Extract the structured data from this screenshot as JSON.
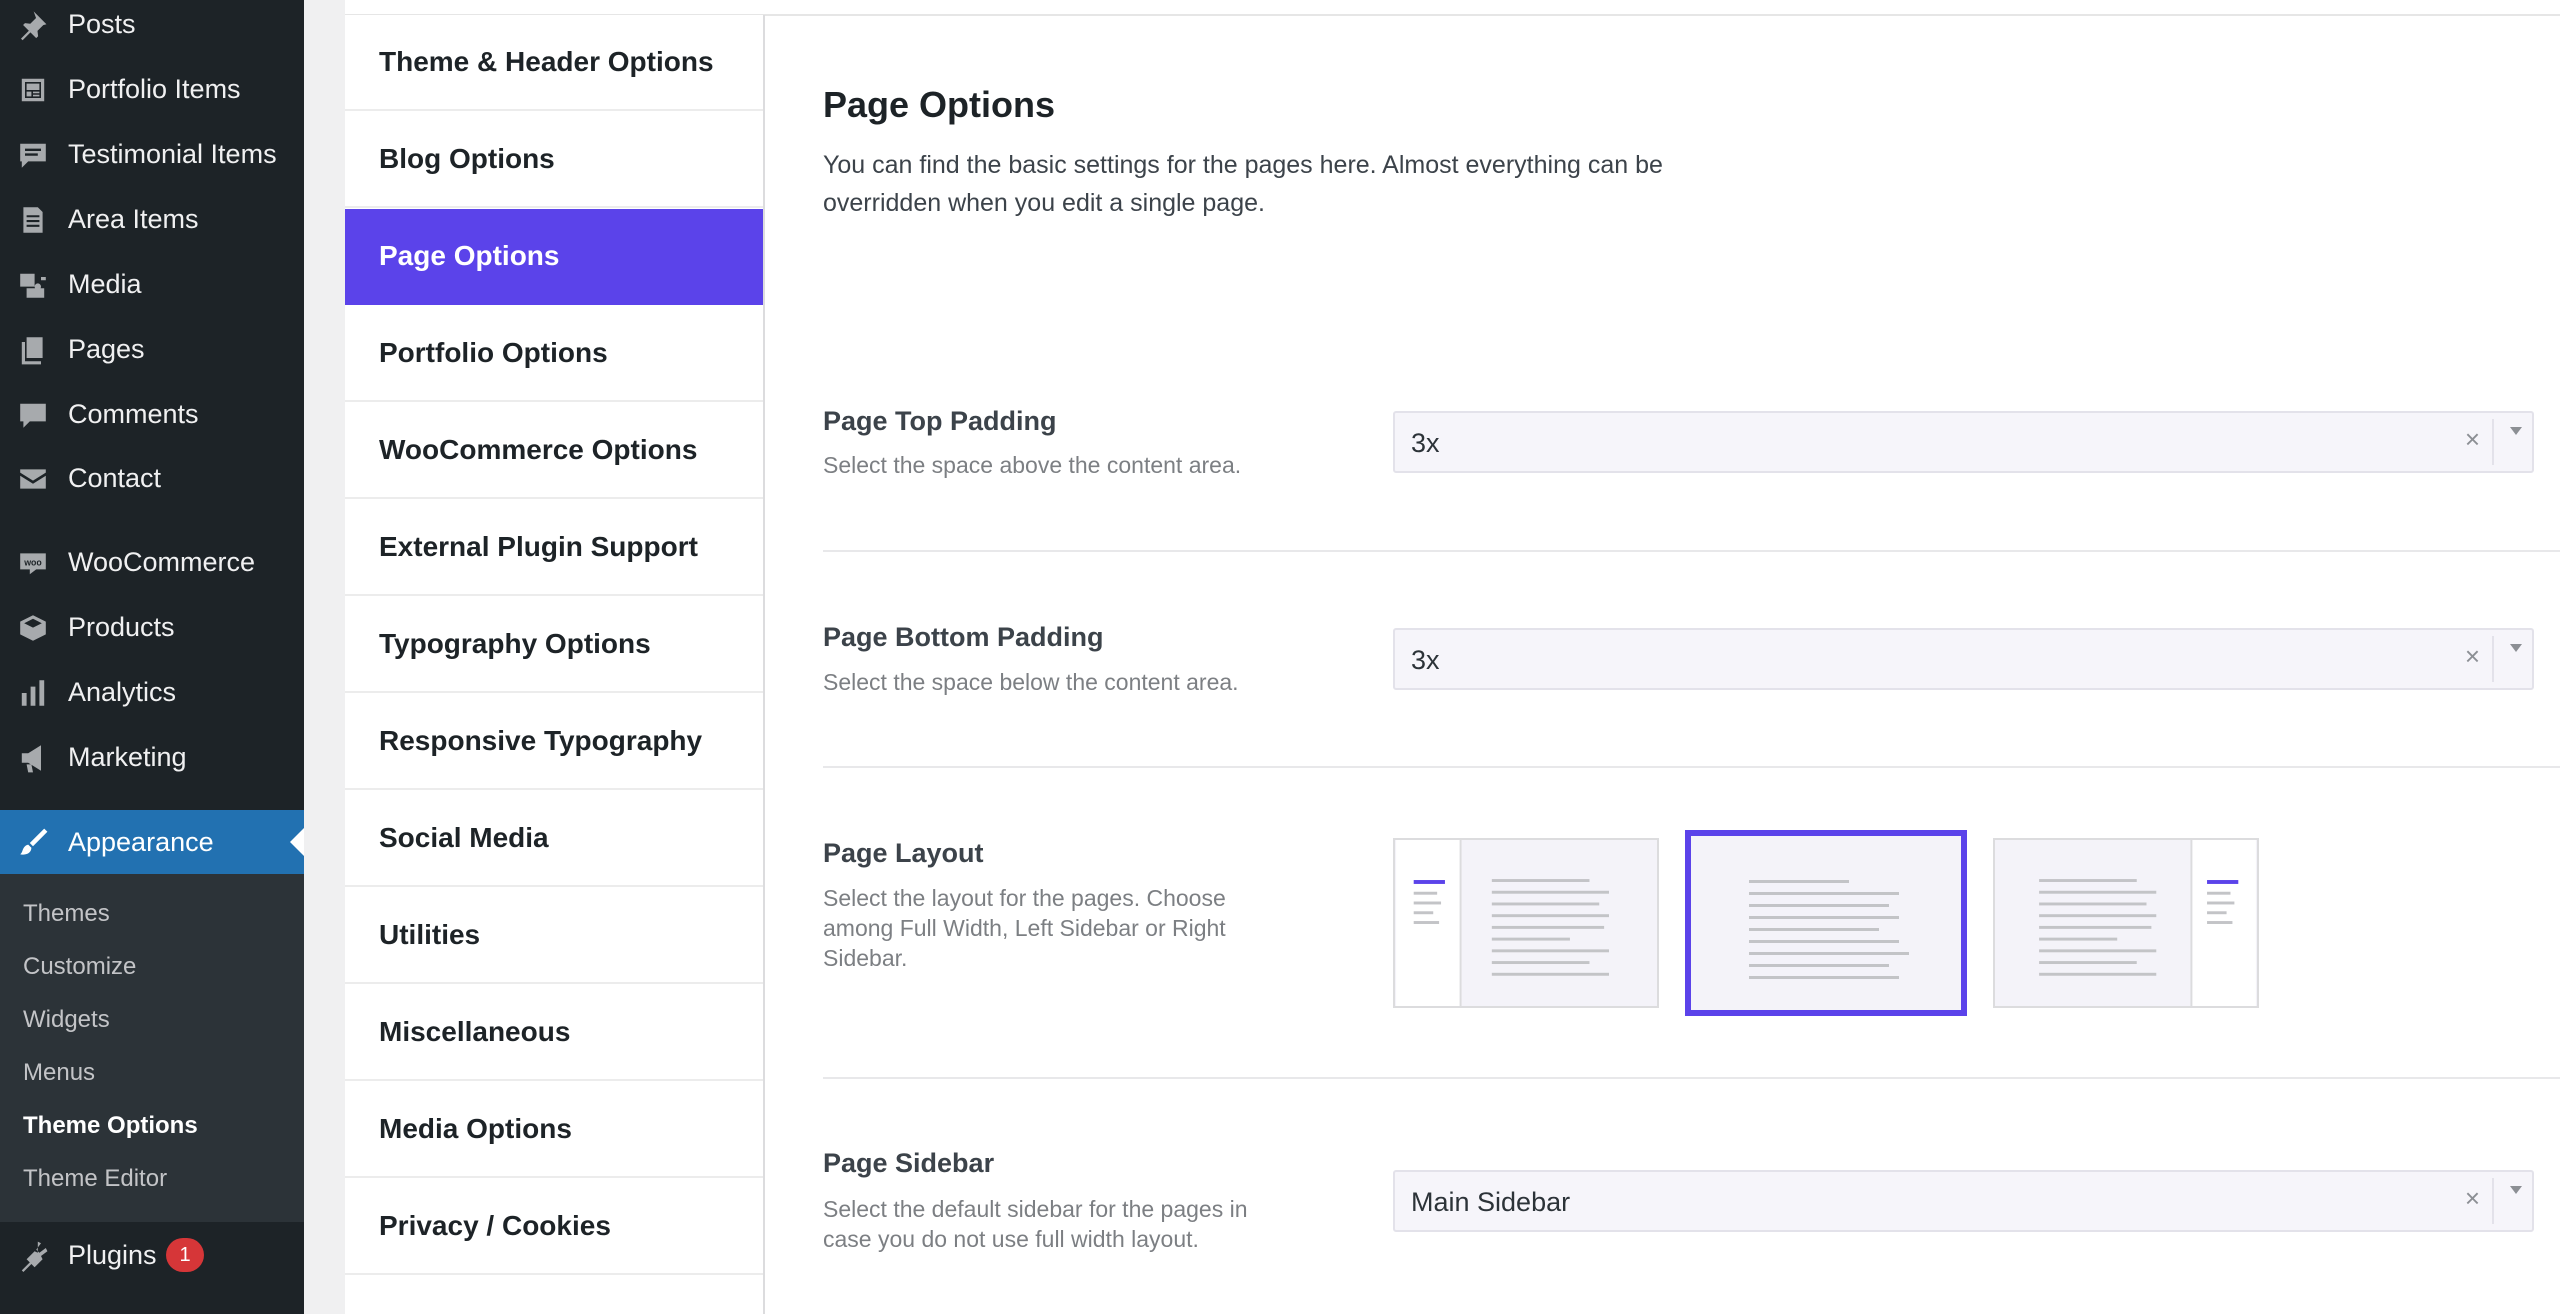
{
  "admin_menu": {
    "items": [
      {
        "label": "Posts",
        "icon": "pin-icon"
      },
      {
        "label": "Portfolio Items",
        "icon": "portfolio-icon"
      },
      {
        "label": "Testimonial Items",
        "icon": "comment-icon"
      },
      {
        "label": "Area Items",
        "icon": "page-icon"
      },
      {
        "label": "Media",
        "icon": "media-icon"
      },
      {
        "label": "Pages",
        "icon": "pages-icon"
      },
      {
        "label": "Comments",
        "icon": "comment-icon"
      },
      {
        "label": "Contact",
        "icon": "mail-icon"
      },
      {
        "label": "WooCommerce",
        "icon": "woo-icon"
      },
      {
        "label": "Products",
        "icon": "products-icon"
      },
      {
        "label": "Analytics",
        "icon": "bar-chart-icon"
      },
      {
        "label": "Marketing",
        "icon": "megaphone-icon"
      },
      {
        "label": "Appearance",
        "icon": "brush-icon",
        "active": true
      },
      {
        "label": "Plugins",
        "icon": "plugin-icon"
      }
    ],
    "appearance_submenu": [
      "Themes",
      "Customize",
      "Widgets",
      "Menus",
      "Theme Options",
      "Theme Editor"
    ],
    "current_submenu": "Theme Options",
    "plugins_badge": "1"
  },
  "options_nav": {
    "items": [
      "Theme & Header Options",
      "Blog Options",
      "Page Options",
      "Portfolio Options",
      "WooCommerce Options",
      "External Plugin Support",
      "Typography Options",
      "Responsive Typography",
      "Social Media",
      "Utilities",
      "Miscellaneous",
      "Media Options",
      "Privacy / Cookies"
    ],
    "active": "Page Options"
  },
  "content": {
    "title": "Page Options",
    "intro": "You can find the basic settings for the pages here. Almost everything can be overridden when you edit a single page.",
    "fields": {
      "top_padding": {
        "label": "Page Top Padding",
        "description": "Select the space above the content area.",
        "value": "3x"
      },
      "bottom_padding": {
        "label": "Page Bottom Padding",
        "description": "Select the space below the content area.",
        "value": "3x"
      },
      "layout": {
        "label": "Page Layout",
        "description": "Select the layout for the pages. Choose among Full Width, Left Sidebar or Right Sidebar.",
        "options": [
          "left-sidebar",
          "full-width",
          "right-sidebar"
        ],
        "selected": "full-width"
      },
      "sidebar": {
        "label": "Page Sidebar",
        "description": "Select the default sidebar for the pages in case you do not use full width layout.",
        "value": "Main Sidebar"
      }
    },
    "clear_symbol": "×"
  },
  "colors": {
    "accent": "#5b43ea",
    "wp_menu_bg": "#1d2327",
    "wp_active": "#2271b1",
    "badge": "#d63638"
  }
}
